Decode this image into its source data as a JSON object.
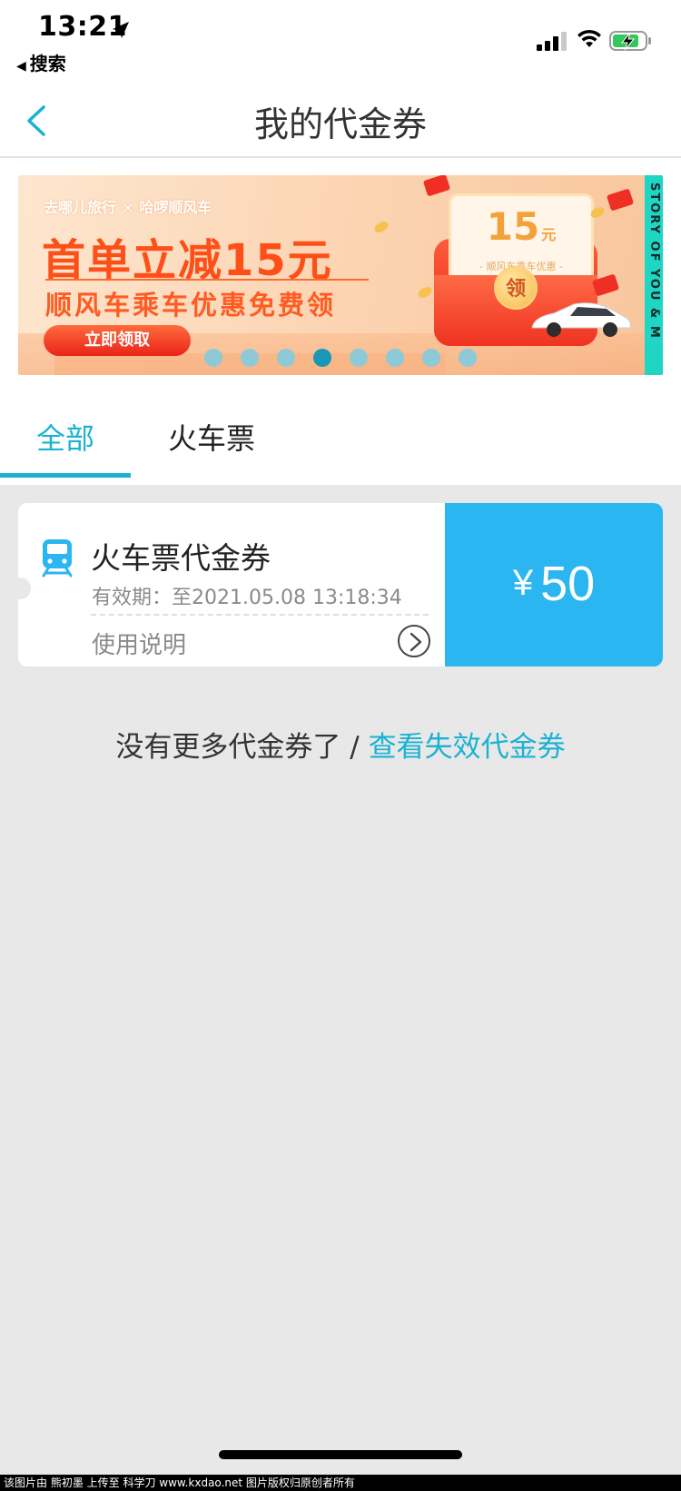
{
  "status_bar": {
    "time": "13:21",
    "back_app_label": "搜索"
  },
  "navbar": {
    "title": "我的代金券"
  },
  "banner": {
    "brand_left": "去哪儿旅行",
    "brand_sep": "×",
    "brand_right": "哈啰顺风车",
    "headline": "首单立减15元",
    "subline": "顺风车乘车优惠免费领",
    "cta": "立即领取",
    "card_amount": "15",
    "card_unit": "元",
    "card_note": "- 顺风车乘车优惠 -",
    "claim_badge": "领",
    "side_text": "STORY OF YOU & M",
    "carousel": {
      "count": 8,
      "active_index": 3
    }
  },
  "tabs": [
    {
      "label": "全部",
      "active": true
    },
    {
      "label": "火车票",
      "active": false
    }
  ],
  "coupon": {
    "icon": "train-icon",
    "title": "火车票代金券",
    "validity": "有效期：至2021.05.08 13:18:34",
    "usage_label": "使用说明",
    "currency": "¥",
    "amount": "50",
    "accent_color": "#2bb6f2"
  },
  "footer": {
    "no_more_text": "没有更多代金券了 / ",
    "view_expired_link": "查看失效代金券"
  },
  "watermark": "该图片由 熊初墨 上传至 科学刀 www.kxdao.net 图片版权归原创者所有",
  "colors": {
    "accent": "#1ab2d2",
    "background": "#e8e8e8"
  }
}
